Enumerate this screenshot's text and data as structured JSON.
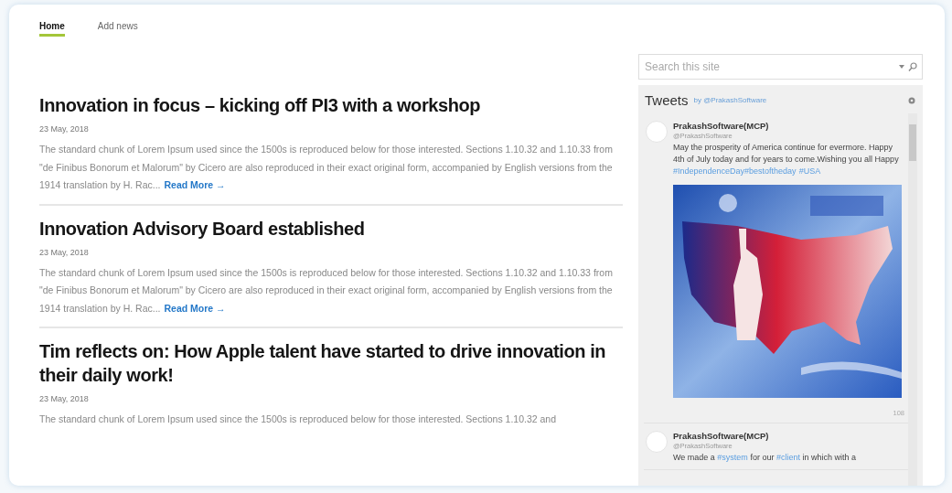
{
  "nav": {
    "tabs": [
      {
        "label": "Home",
        "selected": true
      },
      {
        "label": "Add news",
        "selected": false
      }
    ]
  },
  "articles": [
    {
      "title": "Innovation in focus – kicking off PI3 with a workshop",
      "date": "23 May, 2018",
      "body": "The standard chunk of Lorem Ipsum used since the 1500s is reproduced below for those interested. Sections 1.10.32 and 1.10.33 from \"de Finibus Bonorum et Malorum\" by Cicero are also reproduced in their exact original form, accompanied by English versions from the 1914 translation by H. Rac...",
      "link": "Read More →"
    },
    {
      "title": "Innovation Advisory Board established",
      "date": "23 May, 2018",
      "body": "The standard chunk of Lorem Ipsum used since the 1500s is reproduced below for those interested. Sections 1.10.32 and 1.10.33 from \"de Finibus Bonorum et Malorum\" by Cicero are also reproduced in their exact original form, accompanied by English versions from the 1914 translation by H. Rac...",
      "link": "Read More →"
    },
    {
      "title": "Tim reflects on: How Apple talent have started to drive innovation in their daily work!",
      "date": "23 May, 2018",
      "body": "The standard chunk of Lorem Ipsum used since the 1500s is reproduced below for those interested. Sections 1.10.32 and"
    }
  ],
  "search": {
    "placeholder": "Search this site"
  },
  "tweets": {
    "title": "Tweets",
    "by": "by @PrakashSoftware",
    "items": [
      {
        "name": "PrakashSoftware(MCP)",
        "handle": "@PrakashSoftware",
        "parts": [
          {
            "kind": "plain",
            "text": "May the prosperity of America continue for evermore. Happy 4th of July today and for years to come.Wishing you all Happy "
          },
          {
            "kind": "hashtag",
            "text": "#IndependenceDay"
          },
          {
            "kind": "hashtag",
            "text": "#bestoftheday"
          },
          {
            "kind": "hashtag",
            "text": "#USA",
            "spaced": true
          }
        ],
        "media": {
          "kind": "picture"
        },
        "count": "108"
      },
      {
        "name": "PrakashSoftware(MCP)",
        "handle": "@PrakashSoftware",
        "parts": [
          {
            "kind": "plain",
            "text": "We made a "
          },
          {
            "kind": "hashtag",
            "text": "#system"
          },
          {
            "kind": "plain",
            "text": " for our "
          },
          {
            "kind": "hashtag",
            "text": "#client"
          },
          {
            "kind": "plain",
            "text": " in which with a"
          }
        ]
      }
    ]
  }
}
